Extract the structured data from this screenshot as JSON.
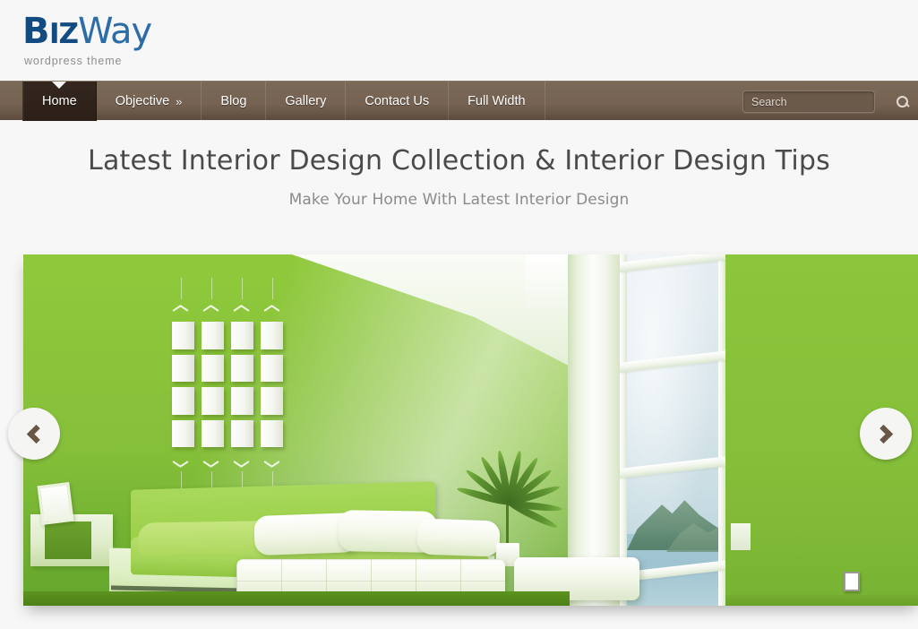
{
  "site": {
    "logo": {
      "part1_bold": "B",
      "part1_small": "IZ",
      "part2": "Way",
      "tagline": "wordpress theme"
    }
  },
  "nav": {
    "items": [
      {
        "label": "Home",
        "active": true,
        "caret": ""
      },
      {
        "label": "Objective",
        "active": false,
        "caret": "»"
      },
      {
        "label": "Blog",
        "active": false,
        "caret": ""
      },
      {
        "label": "Gallery",
        "active": false,
        "caret": ""
      },
      {
        "label": "Contact Us",
        "active": false,
        "caret": ""
      },
      {
        "label": "Full Width",
        "active": false,
        "caret": ""
      }
    ],
    "search": {
      "placeholder": "Search",
      "value": "",
      "icon": "search-icon"
    }
  },
  "hero": {
    "title": "Latest Interior Design Collection & Interior Design Tips",
    "subtitle": "Make Your Home With Latest Interior Design"
  },
  "slider": {
    "prev_icon": "chevron-left-icon",
    "next_icon": "chevron-right-icon",
    "slide_alt": "Green interior bedroom with white picture frame grid and window view"
  },
  "colors": {
    "page_background": "#f7f7f7",
    "nav_background": "#756252",
    "nav_active_background": "#2f231b",
    "logo_dark_blue": "#124a82",
    "logo_light_blue": "#2c6da8",
    "title_gray": "#4a4a4a",
    "subtitle_gray": "#8b8b8b",
    "slide_green": "#8fc33f",
    "arrow_chevron": "#6a5646"
  }
}
